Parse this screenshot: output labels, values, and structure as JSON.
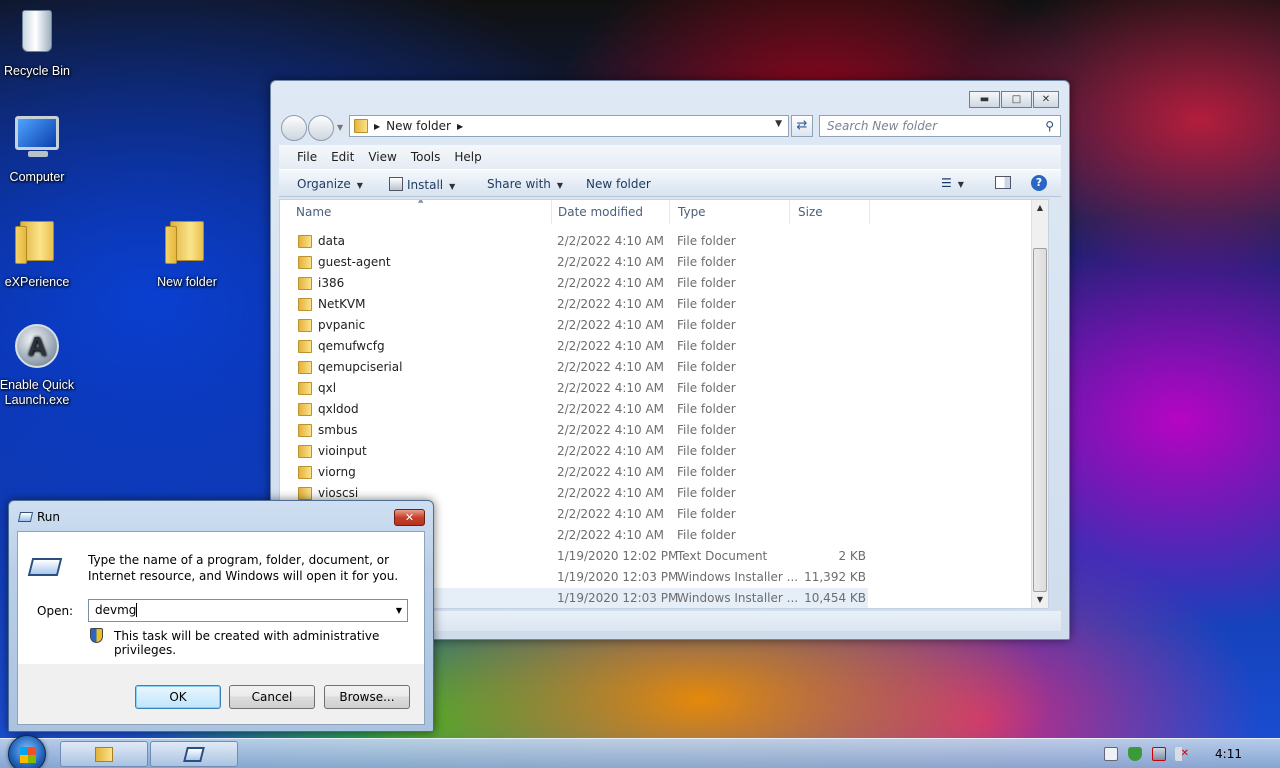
{
  "desktop": {
    "icons": [
      {
        "label": "Recycle Bin"
      },
      {
        "label": "Computer"
      },
      {
        "label": "eXPerience"
      },
      {
        "label": "New folder"
      },
      {
        "label": "Enable Quick Launch.exe"
      }
    ]
  },
  "explorer": {
    "address": {
      "path": "New folder"
    },
    "search_placeholder": "Search New folder",
    "menu": [
      "File",
      "Edit",
      "View",
      "Tools",
      "Help"
    ],
    "toolbar": {
      "organize": "Organize",
      "install": "Install",
      "share_with": "Share with",
      "new_folder": "New folder"
    },
    "columns": [
      "Name",
      "Date modified",
      "Type",
      "Size"
    ],
    "rows": [
      {
        "name": "data",
        "date": "2/2/2022 4:10 AM",
        "type": "File folder",
        "size": ""
      },
      {
        "name": "guest-agent",
        "date": "2/2/2022 4:10 AM",
        "type": "File folder",
        "size": ""
      },
      {
        "name": "i386",
        "date": "2/2/2022 4:10 AM",
        "type": "File folder",
        "size": ""
      },
      {
        "name": "NetKVM",
        "date": "2/2/2022 4:10 AM",
        "type": "File folder",
        "size": ""
      },
      {
        "name": "pvpanic",
        "date": "2/2/2022 4:10 AM",
        "type": "File folder",
        "size": ""
      },
      {
        "name": "qemufwcfg",
        "date": "2/2/2022 4:10 AM",
        "type": "File folder",
        "size": ""
      },
      {
        "name": "qemupciserial",
        "date": "2/2/2022 4:10 AM",
        "type": "File folder",
        "size": ""
      },
      {
        "name": "qxl",
        "date": "2/2/2022 4:10 AM",
        "type": "File folder",
        "size": ""
      },
      {
        "name": "qxldod",
        "date": "2/2/2022 4:10 AM",
        "type": "File folder",
        "size": ""
      },
      {
        "name": "smbus",
        "date": "2/2/2022 4:10 AM",
        "type": "File folder",
        "size": ""
      },
      {
        "name": "vioinput",
        "date": "2/2/2022 4:10 AM",
        "type": "File folder",
        "size": ""
      },
      {
        "name": "viorng",
        "date": "2/2/2022 4:10 AM",
        "type": "File folder",
        "size": ""
      },
      {
        "name": "vioscsi",
        "date": "2/2/2022 4:10 AM",
        "type": "File folder",
        "size": ""
      },
      {
        "name": "",
        "date": "2/2/2022 4:10 AM",
        "type": "File folder",
        "size": ""
      },
      {
        "name": "",
        "date": "2/2/2022 4:10 AM",
        "type": "File folder",
        "size": ""
      },
      {
        "name": "",
        "date": "1/19/2020 12:02 PM",
        "type": "Text Document",
        "size": "2 KB"
      },
      {
        "name": "",
        "date": "1/19/2020 12:03 PM",
        "type": "Windows Installer ...",
        "size": "11,392 KB"
      },
      {
        "name": "",
        "date": "1/19/2020 12:03 PM",
        "type": "Windows Installer ...",
        "size": "10,454 KB"
      }
    ]
  },
  "run_dialog": {
    "title": "Run",
    "description": "Type the name of a program, folder, document, or Internet resource, and Windows will open it for you.",
    "open_label": "Open:",
    "open_value": "devmg",
    "admin_note": "This task will be created with administrative privileges.",
    "ok_label": "OK",
    "cancel_label": "Cancel",
    "browse_label": "Browse..."
  },
  "taskbar": {
    "clock": "4:11"
  }
}
